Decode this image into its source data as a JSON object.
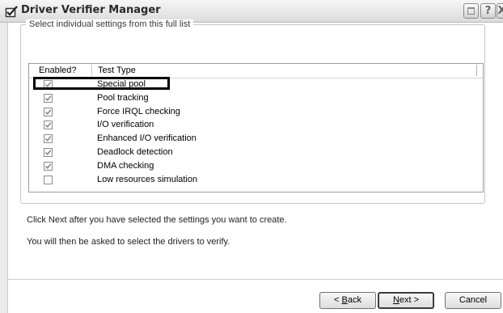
{
  "window": {
    "title": "Driver Verifier Manager",
    "icons": {
      "app": "checked-box-icon",
      "minimize": "minimize-icon",
      "help": "help-icon",
      "close": "close-icon"
    },
    "help_glyph": "?",
    "close_glyph": "X"
  },
  "group": {
    "legend": "Select individual settings from this full list",
    "columns": [
      "Enabled?",
      "Test Type"
    ],
    "rows": [
      {
        "label": "Special pool",
        "checked": true
      },
      {
        "label": "Pool tracking",
        "checked": true
      },
      {
        "label": "Force IRQL checking",
        "checked": true
      },
      {
        "label": "I/O verification",
        "checked": true
      },
      {
        "label": "Enhanced I/O verification",
        "checked": true
      },
      {
        "label": "Deadlock detection",
        "checked": true
      },
      {
        "label": "DMA checking",
        "checked": true
      },
      {
        "label": "Low resources simulation",
        "checked": false
      }
    ]
  },
  "instructions": {
    "line1": "Click Next after you have selected the settings you want to create.",
    "line2": "You will then be asked to select the drivers to verify."
  },
  "buttons": {
    "back": {
      "prefix": "< ",
      "accel": "B",
      "rest": "ack"
    },
    "next": {
      "accel": "N",
      "rest": "ext >"
    },
    "cancel": "Cancel"
  },
  "colors": {
    "highlight_border": "#000000",
    "check_mark": "#8a8a8a"
  }
}
